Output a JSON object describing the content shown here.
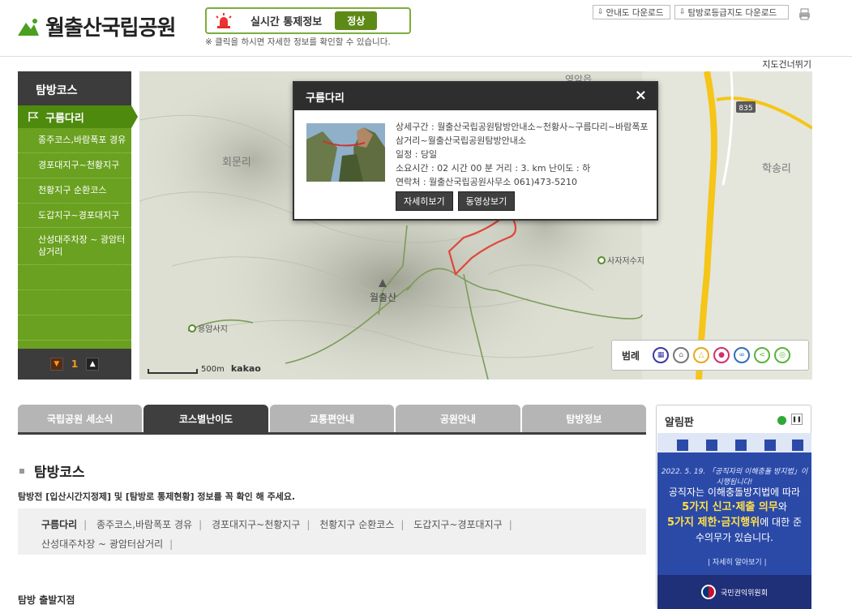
{
  "header": {
    "site_title": "월출산국립공원",
    "control_label": "실시간 통제정보",
    "control_status": "정상",
    "control_note": "※ 클릭을 하시면 자세한 정보를 확인할 수 있습니다.",
    "download_guide": "안내도 다운로드",
    "download_trail": "탐방로등급지도 다운로드",
    "skip_map": "지도건너뛰기"
  },
  "sidebar": {
    "title": "탐방코스",
    "active": "구름다리",
    "items": [
      {
        "label": "종주코스,바람폭포 경유"
      },
      {
        "label": "경포대지구~천황지구"
      },
      {
        "label": "천황지구 순환코스"
      },
      {
        "label": "도갑지구~경포대지구"
      },
      {
        "label": "산성대주차장 ~ 광암터삼거리"
      }
    ],
    "page": "1"
  },
  "map": {
    "labels": {
      "village1": "회문리",
      "village2": "학송리",
      "peak": "월출산",
      "temple": "용암사지",
      "reservoir": "사자저수지",
      "road": "835",
      "top": "영암읍"
    },
    "scale_text": "500m",
    "provider": "kakao",
    "legend_title": "범례",
    "legend_icons": [
      "toilet-icon",
      "shelter-icon",
      "camp-icon",
      "ranger-icon",
      "parking-icon",
      "share-icon",
      "water-icon"
    ]
  },
  "popup": {
    "title": "구름다리",
    "close": "×",
    "detail_label": "상세구간 :",
    "detail_value": "월출산국립공원탐방안내소~천황사~구름다리~바람폭포 삼거리~월출산국립공원탐방안내소",
    "schedule": "일정 : 당일",
    "duration_line": "소요시간 : 02 시간 00 분   거리 : 3. km    난이도 : 하",
    "contact": "연락처 : 월출산국립공원사무소 061)473-5210",
    "btn_detail": "자세히보기",
    "btn_video": "동영상보기"
  },
  "tabs": [
    "국립공원 세소식",
    "코스별난이도",
    "교통편안내",
    "공원안내",
    "탐방정보"
  ],
  "active_tab": 1,
  "content": {
    "section_title": "탐방코스",
    "notice": "탐방전 [입산시간지정제] 및 [탐방로 통제현황] 정보를 꼭 확인 해 주세요.",
    "courses": [
      "구름다리",
      "종주코스,바람폭포 경유",
      "경포대지구~천황지구",
      "천황지구 순환코스",
      "도갑지구~경포대지구",
      "산성대주차장 ~ 광암터삼거리"
    ],
    "sep": "|",
    "start_label": "탐방 출발지점"
  },
  "board": {
    "title": "알림판",
    "banner_date": "2022. 5. 19. 「공직자의 이해충돌 방지법」이 시행됩니다!",
    "banner_text1": "공직자는 이해충돌방지법에 따라",
    "banner_highlight1": "5가지 신고·제출 의무",
    "banner_text2": "와",
    "banner_highlight2": "5가지 제한·금지행위",
    "banner_text3": "에 대한 준수의무가 있습니다.",
    "banner_more": "| 자세히 알아보기 |",
    "banner_org": "국민권익위원회"
  }
}
